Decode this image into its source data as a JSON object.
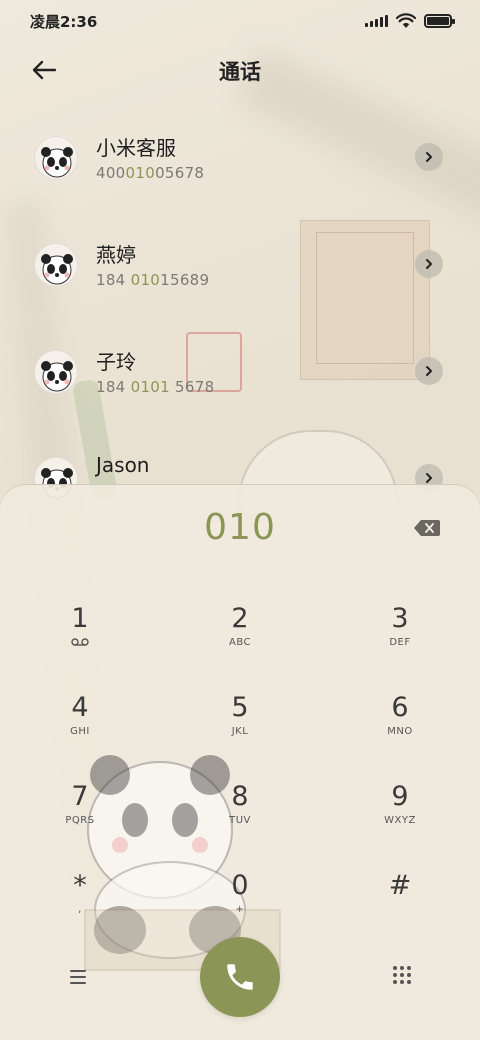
{
  "status_bar": {
    "time": "凌晨2:36",
    "signal_icon": "signal-bars-icon",
    "wifi_icon": "wifi-icon",
    "battery_icon": "battery-icon",
    "battery_level": 1.0
  },
  "header": {
    "title": "通话",
    "back_icon": "back-arrow-icon"
  },
  "contacts": [
    {
      "name": "小米客服",
      "number_pre": "400",
      "number_match": "010",
      "number_post": "05678"
    },
    {
      "name": "燕婷",
      "number_pre": "184 ",
      "number_match": "010",
      "number_post": "15689"
    },
    {
      "name": "子玲",
      "number_pre": "184 ",
      "number_match": "0101",
      "number_post": " 5678"
    },
    {
      "name": "Jason",
      "number_pre": "",
      "number_match": "",
      "number_post": ""
    }
  ],
  "dialpad": {
    "dialed_number": "010",
    "keys": [
      {
        "digit": "1",
        "letters": ""
      },
      {
        "digit": "2",
        "letters": "ABC"
      },
      {
        "digit": "3",
        "letters": "DEF"
      },
      {
        "digit": "4",
        "letters": "GHI"
      },
      {
        "digit": "5",
        "letters": "JKL"
      },
      {
        "digit": "6",
        "letters": "MNO"
      },
      {
        "digit": "7",
        "letters": "PQRS"
      },
      {
        "digit": "8",
        "letters": "TUV"
      },
      {
        "digit": "9",
        "letters": "WXYZ"
      },
      {
        "digit": "*",
        "letters": ","
      },
      {
        "digit": "0",
        "letters": "+"
      },
      {
        "digit": "#",
        "letters": ""
      }
    ]
  },
  "colors": {
    "accent": "#8b9656",
    "background": "#ede6d8",
    "secondary_text": "#7c7a74"
  }
}
